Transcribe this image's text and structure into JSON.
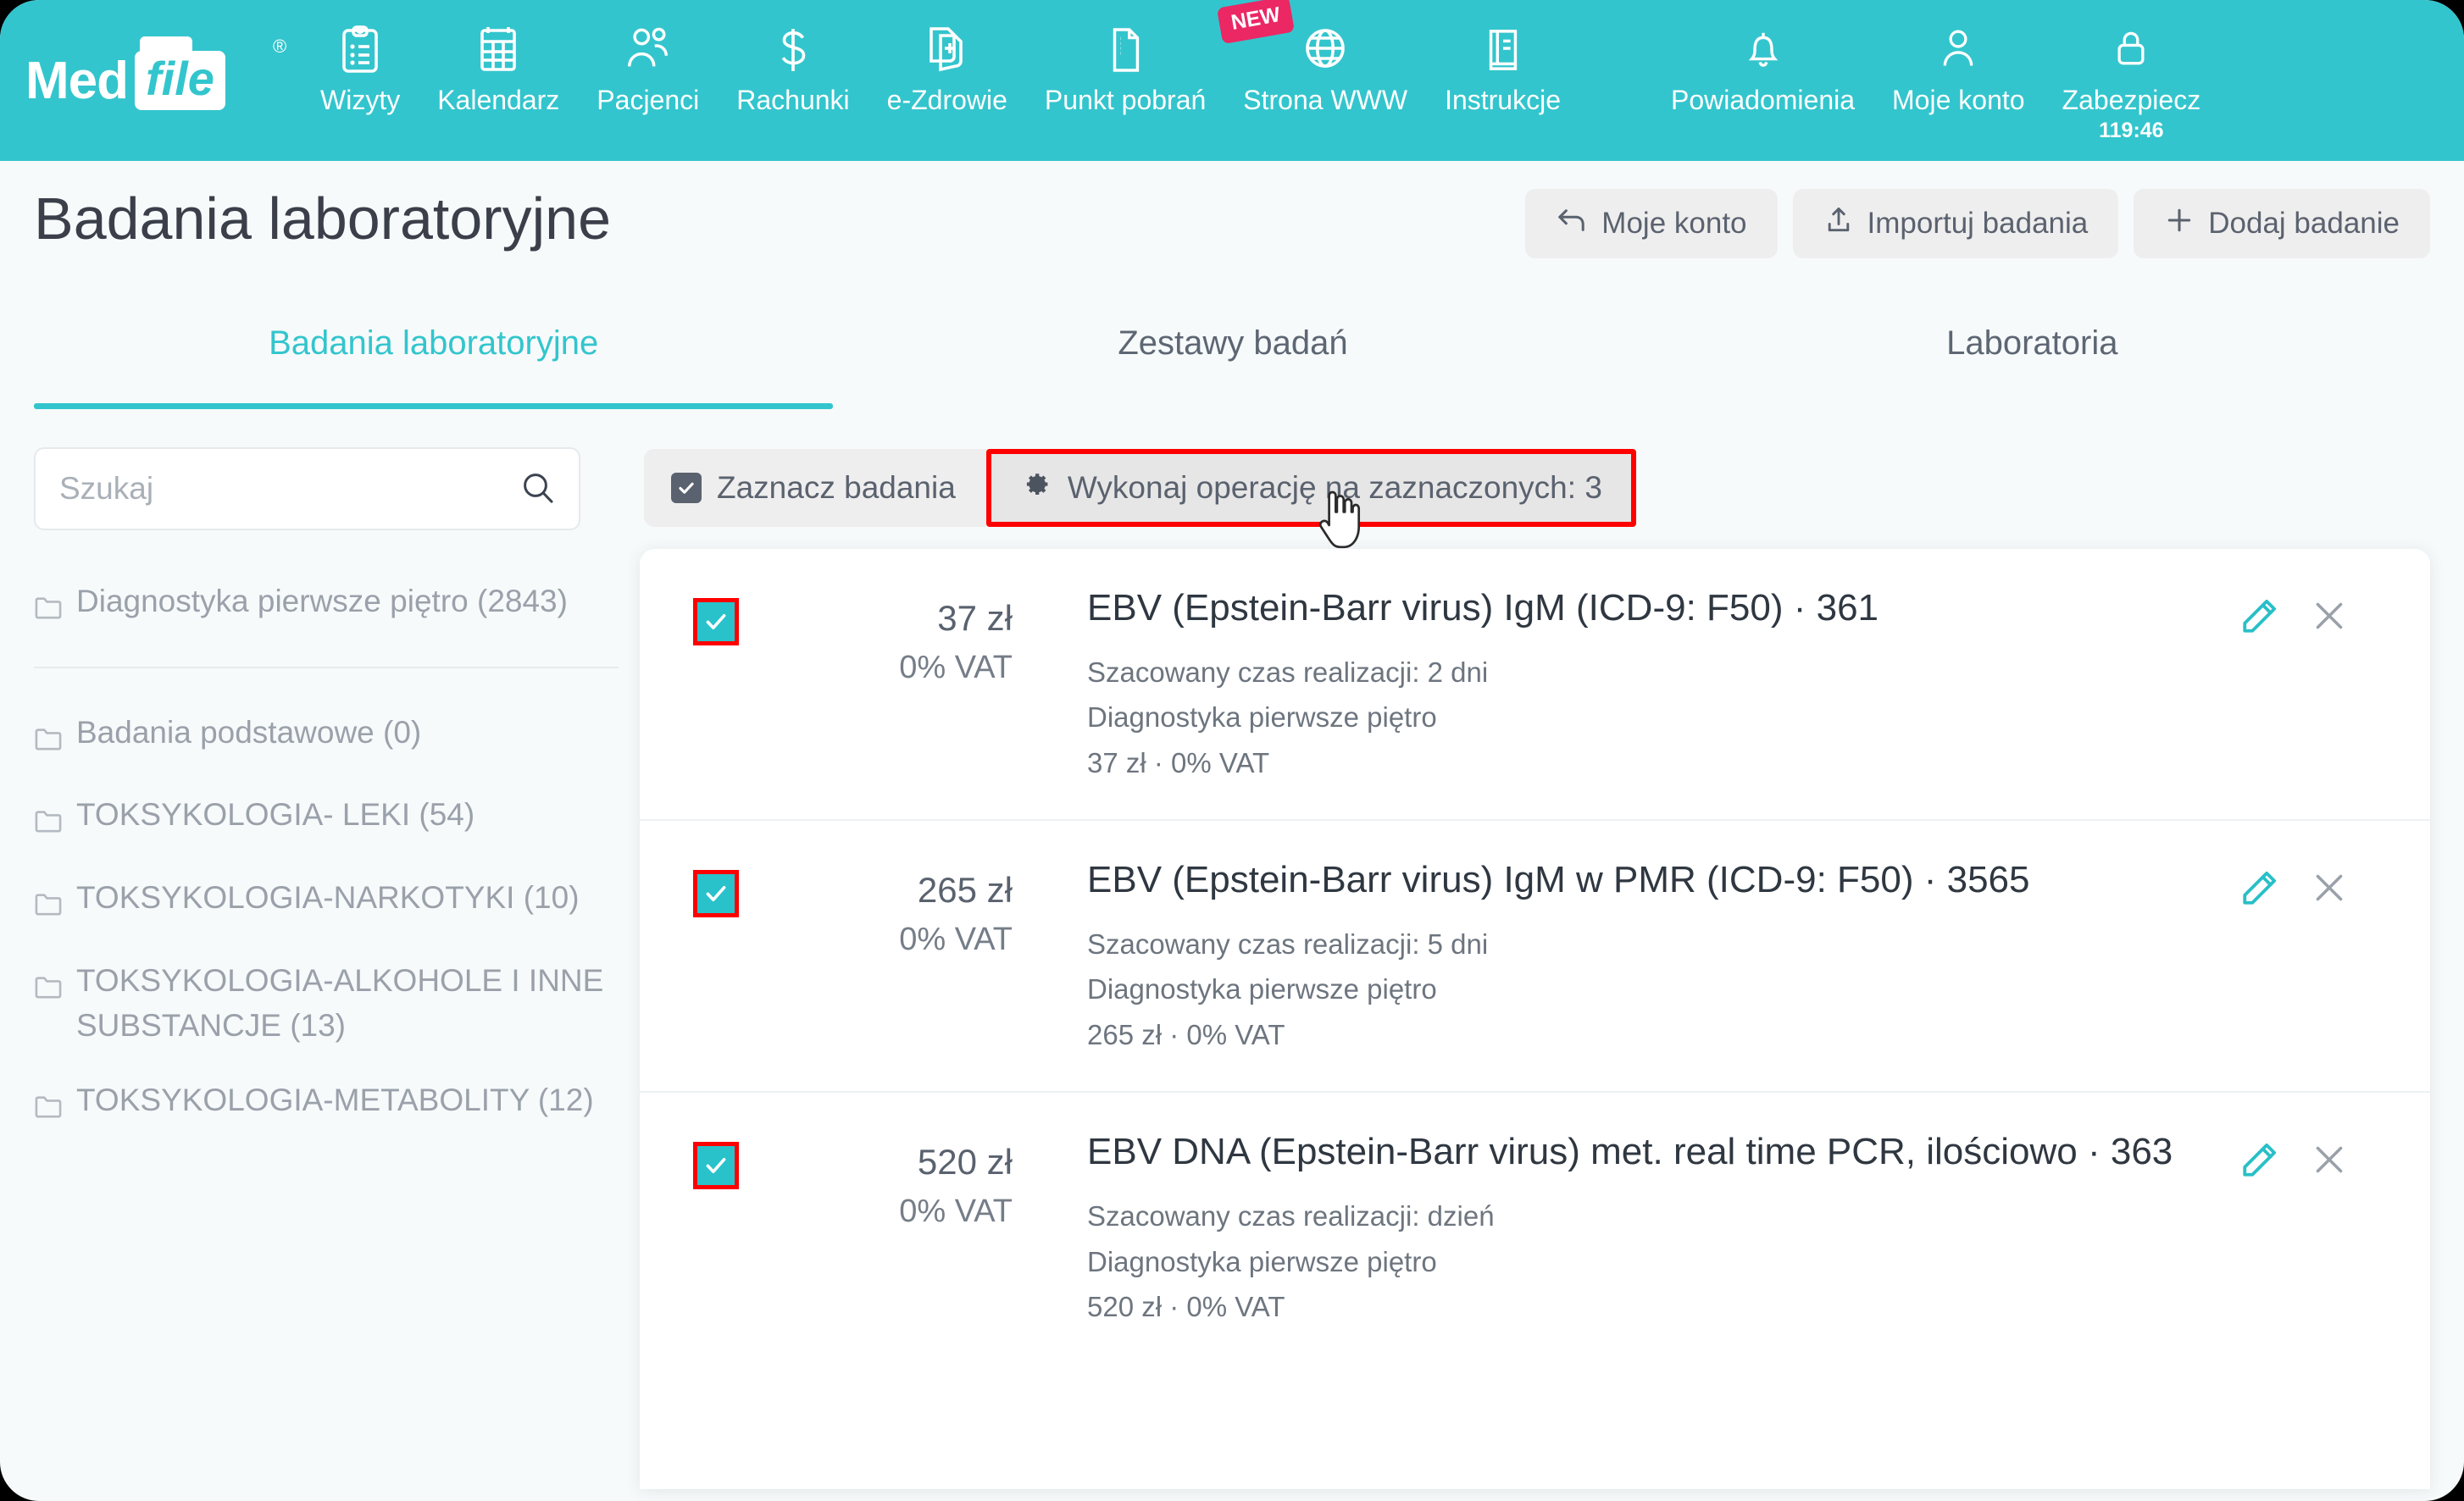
{
  "nav": {
    "logo": {
      "part1": "Med",
      "part2": "file",
      "registered": "®"
    },
    "items": [
      {
        "label": "Wizyty",
        "icon": "clipboard-icon"
      },
      {
        "label": "Kalendarz",
        "icon": "calendar-icon"
      },
      {
        "label": "Pacjenci",
        "icon": "patients-icon"
      },
      {
        "label": "Rachunki",
        "icon": "dollar-icon"
      },
      {
        "label": "e-Zdrowie",
        "icon": "ehealth-icon"
      },
      {
        "label": "Punkt pobrań",
        "icon": "document-icon"
      },
      {
        "label": "Strona WWW",
        "icon": "globe-icon",
        "badge": "NEW"
      },
      {
        "label": "Instrukcje",
        "icon": "book-icon"
      }
    ],
    "right_items": [
      {
        "label": "Powiadomienia",
        "icon": "bell-icon"
      },
      {
        "label": "Moje konto",
        "icon": "user-icon"
      },
      {
        "label": "Zabezpiecz",
        "icon": "lock-icon",
        "timer": "119:46"
      }
    ]
  },
  "header": {
    "title": "Badania laboratoryjne",
    "buttons": [
      {
        "label": "Moje konto",
        "icon": "back-arrow-icon"
      },
      {
        "label": "Importuj badania",
        "icon": "upload-icon"
      },
      {
        "label": "Dodaj badanie",
        "icon": "plus-icon"
      }
    ]
  },
  "tabs": [
    {
      "label": "Badania laboratoryjne",
      "active": true
    },
    {
      "label": "Zestawy badań",
      "active": false
    },
    {
      "label": "Laboratoria",
      "active": false
    }
  ],
  "search": {
    "placeholder": "Szukaj",
    "value": "",
    "icon": "search-icon"
  },
  "sidebar": {
    "primary": [
      {
        "label": "Diagnostyka pierwsze piętro (2843)",
        "icon": "folder-icon"
      }
    ],
    "items": [
      {
        "label": "Badania podstawowe (0)",
        "icon": "folder-icon"
      },
      {
        "label": "TOKSYKOLOGIA- LEKI (54)",
        "icon": "folder-icon"
      },
      {
        "label": "TOKSYKOLOGIA-NARKOTYKI (10)",
        "icon": "folder-icon"
      },
      {
        "label": "TOKSYKOLOGIA-ALKOHOLE I INNE SUBSTANCJE (13)",
        "icon": "folder-icon"
      },
      {
        "label": "TOKSYKOLOGIA-METABOLITY (12)",
        "icon": "folder-icon"
      }
    ]
  },
  "toolbar": {
    "select_label": "Zaznacz badania",
    "select_checked": true,
    "operation_label": "Wykonaj operację na zaznaczonych: 3",
    "operation_icon": "gear-icon",
    "highlight_color": "#ff0000"
  },
  "results": {
    "rows": [
      {
        "checked": true,
        "price": "37 zł",
        "vat": "0% VAT",
        "title": "EBV (Epstein-Barr virus) IgM (ICD-9: F50) · 361",
        "meta_time": "Szacowany czas realizacji: 2 dni",
        "meta_lab": "Diagnostyka pierwsze piętro",
        "meta_price": "37 zł · 0% VAT",
        "edit_icon": "pencil-icon",
        "delete_icon": "close-icon"
      },
      {
        "checked": true,
        "price": "265 zł",
        "vat": "0% VAT",
        "title": "EBV (Epstein-Barr virus) IgM w PMR (ICD-9: F50) · 3565",
        "meta_time": "Szacowany czas realizacji: 5 dni",
        "meta_lab": "Diagnostyka pierwsze piętro",
        "meta_price": "265 zł · 0% VAT",
        "edit_icon": "pencil-icon",
        "delete_icon": "close-icon"
      },
      {
        "checked": true,
        "price": "520 zł",
        "vat": "0% VAT",
        "title": "EBV DNA (Epstein-Barr virus) met. real time PCR, ilościowo · 363",
        "meta_time": "Szacowany czas realizacji: dzień",
        "meta_lab": "Diagnostyka pierwsze piętro",
        "meta_price": "520 zł · 0% VAT",
        "edit_icon": "pencil-icon",
        "delete_icon": "close-icon"
      }
    ]
  },
  "colors": {
    "brand": "#33c5cd",
    "badge": "#eb2764",
    "highlight": "#ff0000",
    "text": "#5a626f"
  }
}
